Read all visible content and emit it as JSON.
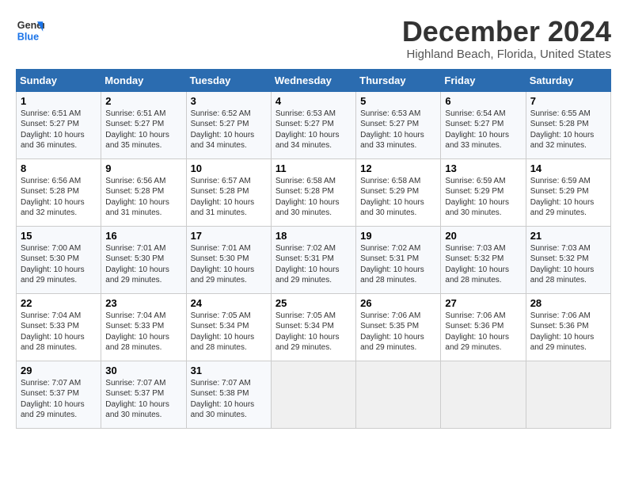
{
  "header": {
    "logo_line1": "General",
    "logo_line2": "Blue",
    "month_year": "December 2024",
    "location": "Highland Beach, Florida, United States"
  },
  "days_of_week": [
    "Sunday",
    "Monday",
    "Tuesday",
    "Wednesday",
    "Thursday",
    "Friday",
    "Saturday"
  ],
  "weeks": [
    [
      {
        "day": 1,
        "sunrise": "6:51 AM",
        "sunset": "5:27 PM",
        "daylight": "10 hours and 36 minutes."
      },
      {
        "day": 2,
        "sunrise": "6:51 AM",
        "sunset": "5:27 PM",
        "daylight": "10 hours and 35 minutes."
      },
      {
        "day": 3,
        "sunrise": "6:52 AM",
        "sunset": "5:27 PM",
        "daylight": "10 hours and 34 minutes."
      },
      {
        "day": 4,
        "sunrise": "6:53 AM",
        "sunset": "5:27 PM",
        "daylight": "10 hours and 34 minutes."
      },
      {
        "day": 5,
        "sunrise": "6:53 AM",
        "sunset": "5:27 PM",
        "daylight": "10 hours and 33 minutes."
      },
      {
        "day": 6,
        "sunrise": "6:54 AM",
        "sunset": "5:27 PM",
        "daylight": "10 hours and 33 minutes."
      },
      {
        "day": 7,
        "sunrise": "6:55 AM",
        "sunset": "5:28 PM",
        "daylight": "10 hours and 32 minutes."
      }
    ],
    [
      {
        "day": 8,
        "sunrise": "6:56 AM",
        "sunset": "5:28 PM",
        "daylight": "10 hours and 32 minutes."
      },
      {
        "day": 9,
        "sunrise": "6:56 AM",
        "sunset": "5:28 PM",
        "daylight": "10 hours and 31 minutes."
      },
      {
        "day": 10,
        "sunrise": "6:57 AM",
        "sunset": "5:28 PM",
        "daylight": "10 hours and 31 minutes."
      },
      {
        "day": 11,
        "sunrise": "6:58 AM",
        "sunset": "5:28 PM",
        "daylight": "10 hours and 30 minutes."
      },
      {
        "day": 12,
        "sunrise": "6:58 AM",
        "sunset": "5:29 PM",
        "daylight": "10 hours and 30 minutes."
      },
      {
        "day": 13,
        "sunrise": "6:59 AM",
        "sunset": "5:29 PM",
        "daylight": "10 hours and 30 minutes."
      },
      {
        "day": 14,
        "sunrise": "6:59 AM",
        "sunset": "5:29 PM",
        "daylight": "10 hours and 29 minutes."
      }
    ],
    [
      {
        "day": 15,
        "sunrise": "7:00 AM",
        "sunset": "5:30 PM",
        "daylight": "10 hours and 29 minutes."
      },
      {
        "day": 16,
        "sunrise": "7:01 AM",
        "sunset": "5:30 PM",
        "daylight": "10 hours and 29 minutes."
      },
      {
        "day": 17,
        "sunrise": "7:01 AM",
        "sunset": "5:30 PM",
        "daylight": "10 hours and 29 minutes."
      },
      {
        "day": 18,
        "sunrise": "7:02 AM",
        "sunset": "5:31 PM",
        "daylight": "10 hours and 29 minutes."
      },
      {
        "day": 19,
        "sunrise": "7:02 AM",
        "sunset": "5:31 PM",
        "daylight": "10 hours and 28 minutes."
      },
      {
        "day": 20,
        "sunrise": "7:03 AM",
        "sunset": "5:32 PM",
        "daylight": "10 hours and 28 minutes."
      },
      {
        "day": 21,
        "sunrise": "7:03 AM",
        "sunset": "5:32 PM",
        "daylight": "10 hours and 28 minutes."
      }
    ],
    [
      {
        "day": 22,
        "sunrise": "7:04 AM",
        "sunset": "5:33 PM",
        "daylight": "10 hours and 28 minutes."
      },
      {
        "day": 23,
        "sunrise": "7:04 AM",
        "sunset": "5:33 PM",
        "daylight": "10 hours and 28 minutes."
      },
      {
        "day": 24,
        "sunrise": "7:05 AM",
        "sunset": "5:34 PM",
        "daylight": "10 hours and 28 minutes."
      },
      {
        "day": 25,
        "sunrise": "7:05 AM",
        "sunset": "5:34 PM",
        "daylight": "10 hours and 29 minutes."
      },
      {
        "day": 26,
        "sunrise": "7:06 AM",
        "sunset": "5:35 PM",
        "daylight": "10 hours and 29 minutes."
      },
      {
        "day": 27,
        "sunrise": "7:06 AM",
        "sunset": "5:36 PM",
        "daylight": "10 hours and 29 minutes."
      },
      {
        "day": 28,
        "sunrise": "7:06 AM",
        "sunset": "5:36 PM",
        "daylight": "10 hours and 29 minutes."
      }
    ],
    [
      {
        "day": 29,
        "sunrise": "7:07 AM",
        "sunset": "5:37 PM",
        "daylight": "10 hours and 29 minutes."
      },
      {
        "day": 30,
        "sunrise": "7:07 AM",
        "sunset": "5:37 PM",
        "daylight": "10 hours and 30 minutes."
      },
      {
        "day": 31,
        "sunrise": "7:07 AM",
        "sunset": "5:38 PM",
        "daylight": "10 hours and 30 minutes."
      },
      null,
      null,
      null,
      null
    ]
  ]
}
